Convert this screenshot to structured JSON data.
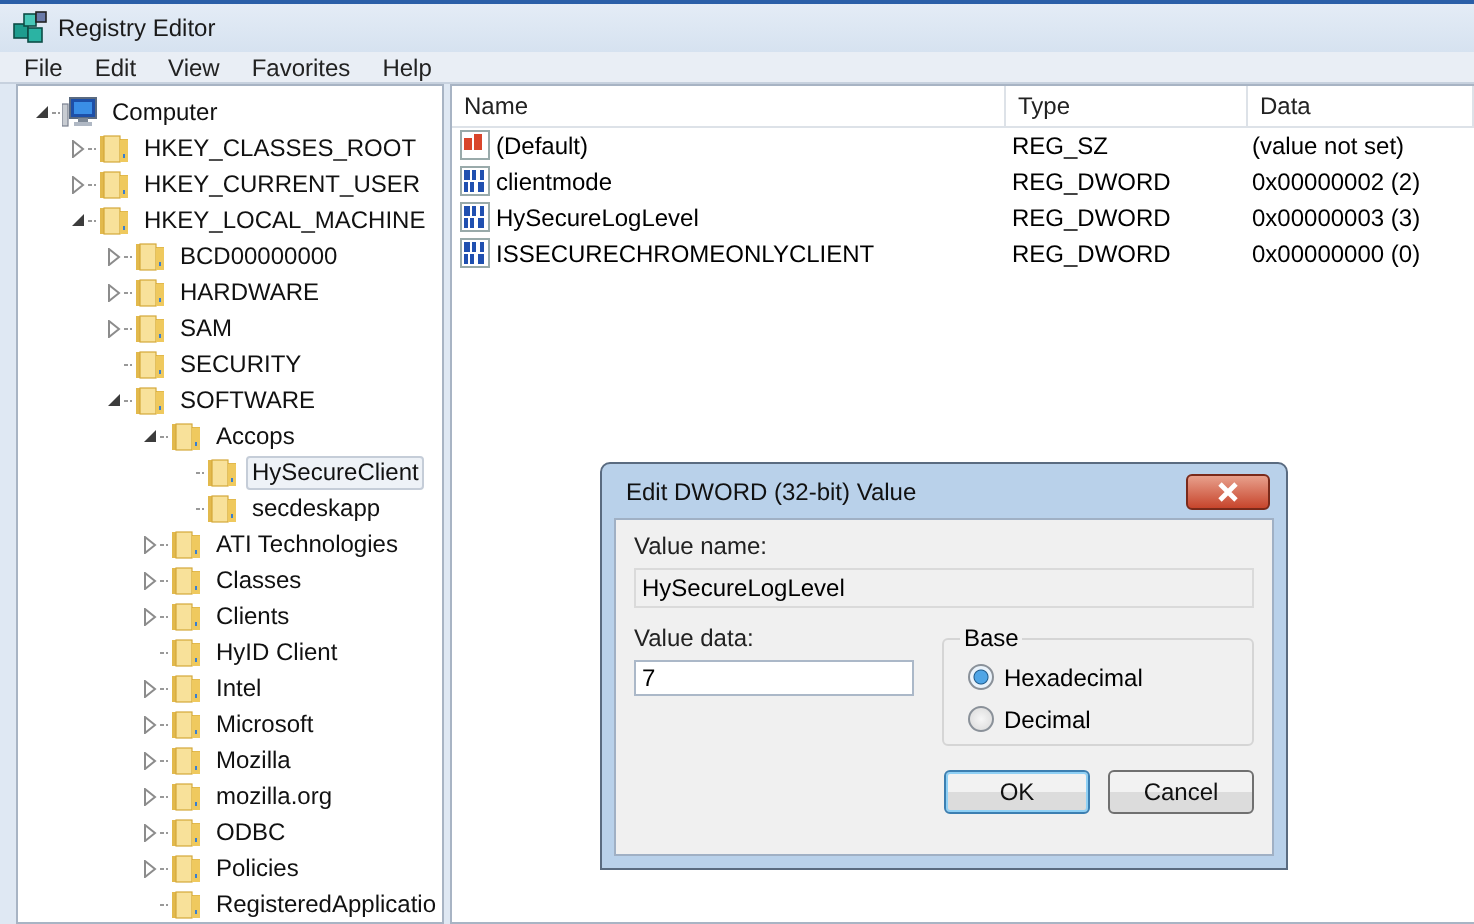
{
  "window": {
    "title": "Registry Editor"
  },
  "menu": [
    "File",
    "Edit",
    "View",
    "Favorites",
    "Help"
  ],
  "tree": [
    {
      "label": "Computer",
      "kind": "computer",
      "expanded": true,
      "selected": false,
      "children": [
        {
          "label": "HKEY_CLASSES_ROOT",
          "expanded": false,
          "selected": false
        },
        {
          "label": "HKEY_CURRENT_USER",
          "expanded": false,
          "selected": false
        },
        {
          "label": "HKEY_LOCAL_MACHINE",
          "expanded": true,
          "selected": false,
          "children": [
            {
              "label": "BCD00000000",
              "expanded": false,
              "selected": false
            },
            {
              "label": "HARDWARE",
              "expanded": false,
              "selected": false
            },
            {
              "label": "SAM",
              "expanded": false,
              "selected": false
            },
            {
              "label": "SECURITY",
              "selected": false
            },
            {
              "label": "SOFTWARE",
              "expanded": true,
              "selected": false,
              "children": [
                {
                  "label": "Accops",
                  "expanded": true,
                  "selected": false,
                  "children": [
                    {
                      "label": "HySecureClient",
                      "selected": true
                    },
                    {
                      "label": "secdeskapp",
                      "selected": false
                    }
                  ]
                },
                {
                  "label": "ATI Technologies",
                  "expanded": false,
                  "selected": false
                },
                {
                  "label": "Classes",
                  "expanded": false,
                  "selected": false
                },
                {
                  "label": "Clients",
                  "expanded": false,
                  "selected": false
                },
                {
                  "label": "HyID Client",
                  "selected": false
                },
                {
                  "label": "Intel",
                  "expanded": false,
                  "selected": false
                },
                {
                  "label": "Microsoft",
                  "expanded": false,
                  "selected": false
                },
                {
                  "label": "Mozilla",
                  "expanded": false,
                  "selected": false
                },
                {
                  "label": "mozilla.org",
                  "expanded": false,
                  "selected": false
                },
                {
                  "label": "ODBC",
                  "expanded": false,
                  "selected": false
                },
                {
                  "label": "Policies",
                  "expanded": false,
                  "selected": false
                },
                {
                  "label": "RegisteredApplicatio",
                  "selected": false
                }
              ]
            }
          ]
        }
      ]
    }
  ],
  "table": {
    "columns": [
      "Name",
      "Type",
      "Data"
    ],
    "rows": [
      {
        "kind": "string",
        "name": "(Default)",
        "type": "REG_SZ",
        "data": "(value not set)"
      },
      {
        "kind": "binary",
        "name": "clientmode",
        "type": "REG_DWORD",
        "data": "0x00000002 (2)"
      },
      {
        "kind": "binary",
        "name": "HySecureLogLevel",
        "type": "REG_DWORD",
        "data": "0x00000003 (3)"
      },
      {
        "kind": "binary",
        "name": "ISSECURECHROMEONLYCLIENT",
        "type": "REG_DWORD",
        "data": "0x00000000 (0)"
      }
    ]
  },
  "dialog": {
    "title": "Edit DWORD (32-bit) Value",
    "value_name_label": "Value name:",
    "value_name": "HySecureLogLevel",
    "value_data_label": "Value data:",
    "value_data": "7",
    "base": {
      "label": "Base",
      "options": [
        {
          "label": "Hexadecimal",
          "selected": true
        },
        {
          "label": "Decimal",
          "selected": false
        }
      ]
    },
    "buttons": [
      {
        "label": "OK",
        "default": true
      },
      {
        "label": "Cancel",
        "default": false
      }
    ]
  }
}
